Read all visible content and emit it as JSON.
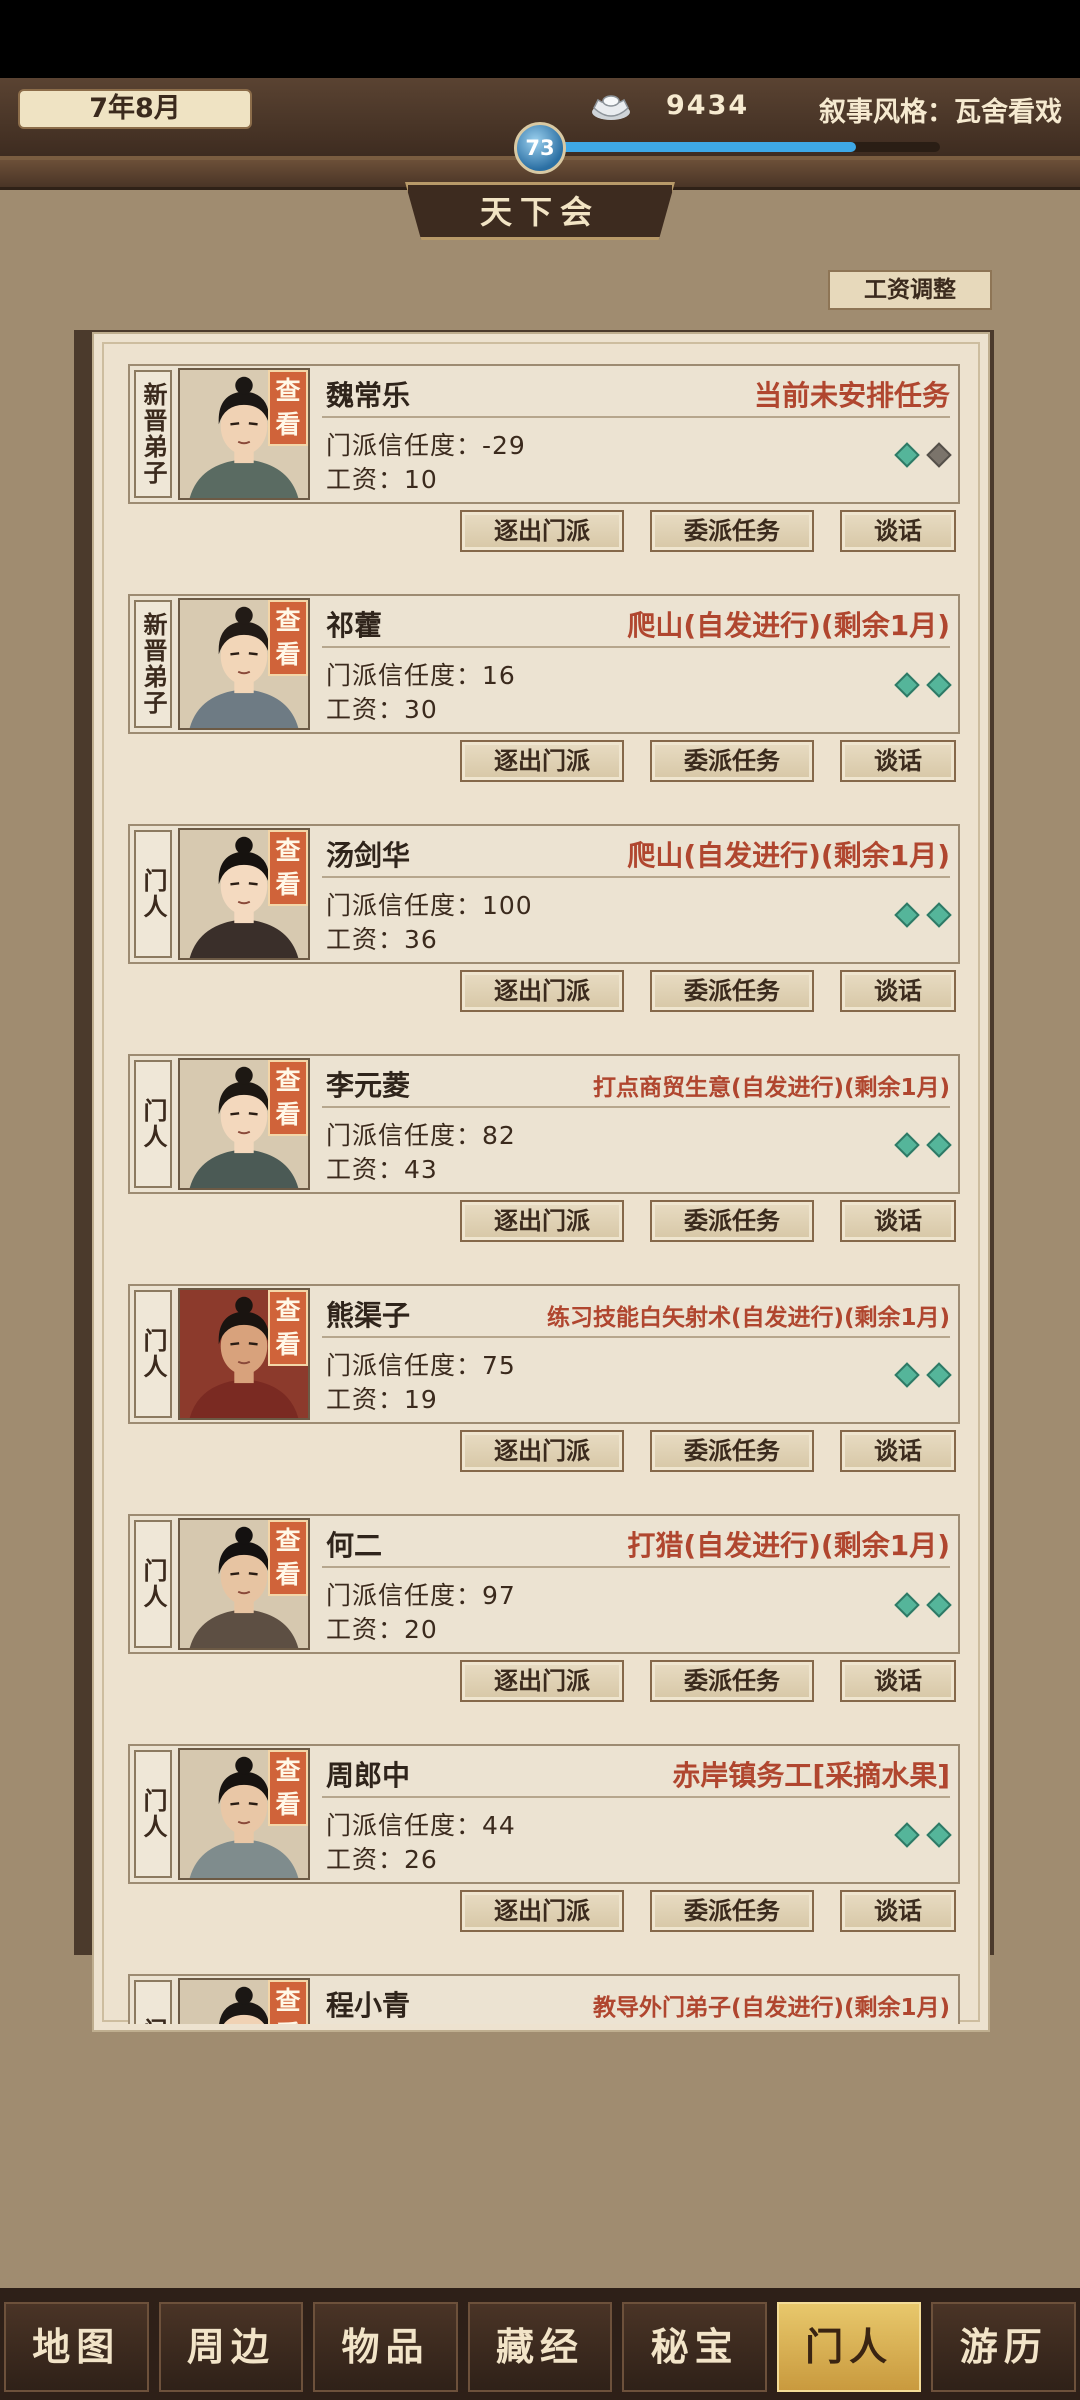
{
  "header": {
    "date": "7年8月",
    "silver_icon": "silver-ingot-icon",
    "silver": "9434",
    "narrative_style": "叙事风格：瓦舍看戏",
    "level": "73",
    "level_progress": 0.78
  },
  "sect_name": "天下会",
  "wage_adjust_label": "工资调整",
  "labels": {
    "view": "查看",
    "expel": "逐出门派",
    "assign": "委派任务",
    "talk": "谈话"
  },
  "members": [
    {
      "rank": "新晋弟子",
      "name": "魏常乐",
      "task": "当前未安排任务",
      "trust": "门派信任度：-29",
      "wage": "工资：10",
      "diamonds": [
        "teal",
        "gray"
      ]
    },
    {
      "rank": "新晋弟子",
      "name": "祁藿",
      "task": "爬山(自发进行)(剩余1月)",
      "trust": "门派信任度：16",
      "wage": "工资：30",
      "diamonds": [
        "teal",
        "teal"
      ]
    },
    {
      "rank": "门人",
      "name": "汤剑华",
      "task": "爬山(自发进行)(剩余1月)",
      "trust": "门派信任度：100",
      "wage": "工资：36",
      "diamonds": [
        "teal",
        "teal"
      ]
    },
    {
      "rank": "门人",
      "name": "李元菱",
      "task": "打点商贸生意(自发进行)(剩余1月)",
      "trust": "门派信任度：82",
      "wage": "工资：43",
      "diamonds": [
        "teal",
        "teal"
      ]
    },
    {
      "rank": "门人",
      "name": "熊渠子",
      "task": "练习技能白矢射术(自发进行)(剩余1月)",
      "trust": "门派信任度：75",
      "wage": "工资：19",
      "diamonds": [
        "teal",
        "teal"
      ]
    },
    {
      "rank": "门人",
      "name": "何二",
      "task": "打猎(自发进行)(剩余1月)",
      "trust": "门派信任度：97",
      "wage": "工资：20",
      "diamonds": [
        "teal",
        "teal"
      ]
    },
    {
      "rank": "门人",
      "name": "周郎中",
      "task": "赤岸镇务工[采摘水果]",
      "trust": "门派信任度：44",
      "wage": "工资：26",
      "diamonds": [
        "teal",
        "teal"
      ]
    },
    {
      "rank": "门人",
      "name": "程小青",
      "task": "教导外门弟子(自发进行)(剩余1月)",
      "trust": "",
      "wage": "",
      "diamonds": []
    }
  ],
  "nav": {
    "tabs": [
      "地图",
      "周边",
      "物品",
      "藏经",
      "秘宝",
      "门人",
      "游历"
    ],
    "active": "门人"
  }
}
